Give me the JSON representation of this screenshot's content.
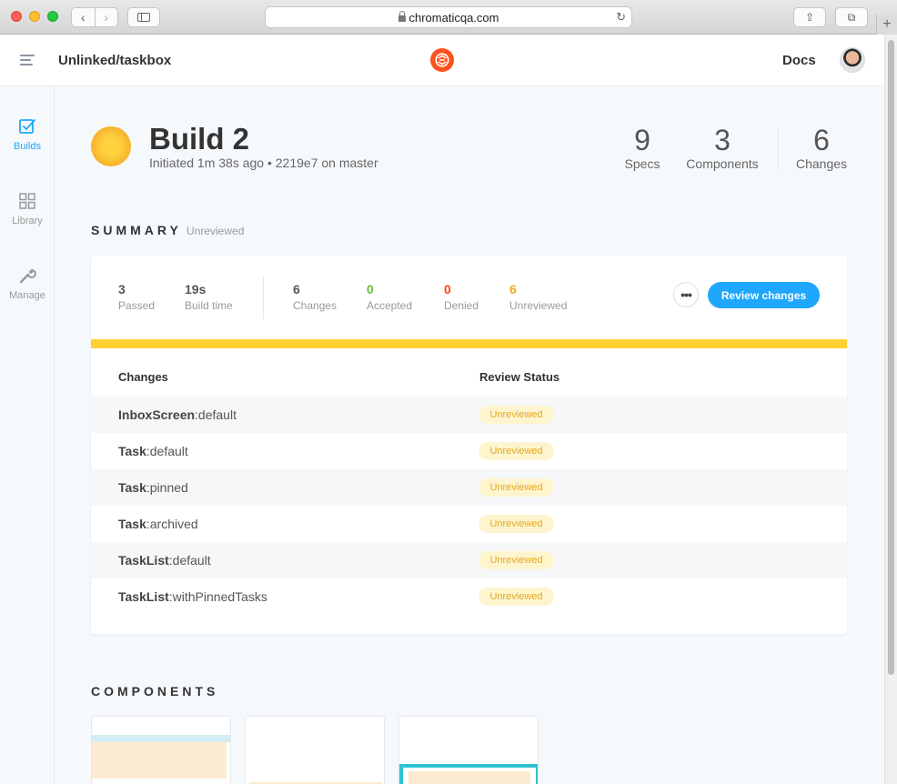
{
  "browser": {
    "url": "chromaticqa.com",
    "back_glyph": "‹",
    "forward_glyph": "›",
    "reload_glyph": "↻",
    "share_glyph": "⇧",
    "tabs_glyph": "⧉",
    "newtab_glyph": "+"
  },
  "header": {
    "project": "Unlinked/taskbox",
    "docs_label": "Docs"
  },
  "left_nav": [
    {
      "label": "Builds",
      "icon": "builds-checkbox-icon",
      "active": true
    },
    {
      "label": "Library",
      "icon": "library-grid-icon",
      "active": false
    },
    {
      "label": "Manage",
      "icon": "manage-wrench-icon",
      "active": false
    }
  ],
  "build": {
    "title": "Build 2",
    "meta": "Initiated 1m 38s ago • 2219e7 on master",
    "stats": [
      {
        "value": "9",
        "label": "Specs"
      },
      {
        "value": "3",
        "label": "Components"
      },
      {
        "value": "6",
        "label": "Changes"
      }
    ]
  },
  "summary": {
    "title": "SUMMARY",
    "status": "Unreviewed",
    "stats": [
      {
        "value": "3",
        "label": "Passed",
        "color": "#555555"
      },
      {
        "value": "19s",
        "label": "Build time",
        "color": "#555555"
      },
      {
        "value": "6",
        "label": "Changes",
        "color": "#555555"
      },
      {
        "value": "0",
        "label": "Accepted",
        "color": "#66bf3c"
      },
      {
        "value": "0",
        "label": "Denied",
        "color": "#ff4400"
      },
      {
        "value": "6",
        "label": "Unreviewed",
        "color": "#f5a623"
      }
    ],
    "more_glyph": "•••",
    "review_button": "Review changes",
    "table": {
      "headers": [
        "Changes",
        "Review Status"
      ],
      "rows": [
        {
          "component": "InboxScreen",
          "story": ":default",
          "status": "Unreviewed"
        },
        {
          "component": "Task",
          "story": ":default",
          "status": "Unreviewed"
        },
        {
          "component": "Task",
          "story": ":pinned",
          "status": "Unreviewed"
        },
        {
          "component": "Task",
          "story": ":archived",
          "status": "Unreviewed"
        },
        {
          "component": "TaskList",
          "story": ":default",
          "status": "Unreviewed"
        },
        {
          "component": "TaskList",
          "story": ":withPinnedTasks",
          "status": "Unreviewed"
        }
      ]
    }
  },
  "components": {
    "title": "COMPONENTS"
  },
  "colors": {
    "accent": "#1ea7fd",
    "brand": "#fc521f",
    "progress": "#fed12f",
    "badge_bg": "#fef5cf",
    "badge_text": "#e5a71e"
  }
}
